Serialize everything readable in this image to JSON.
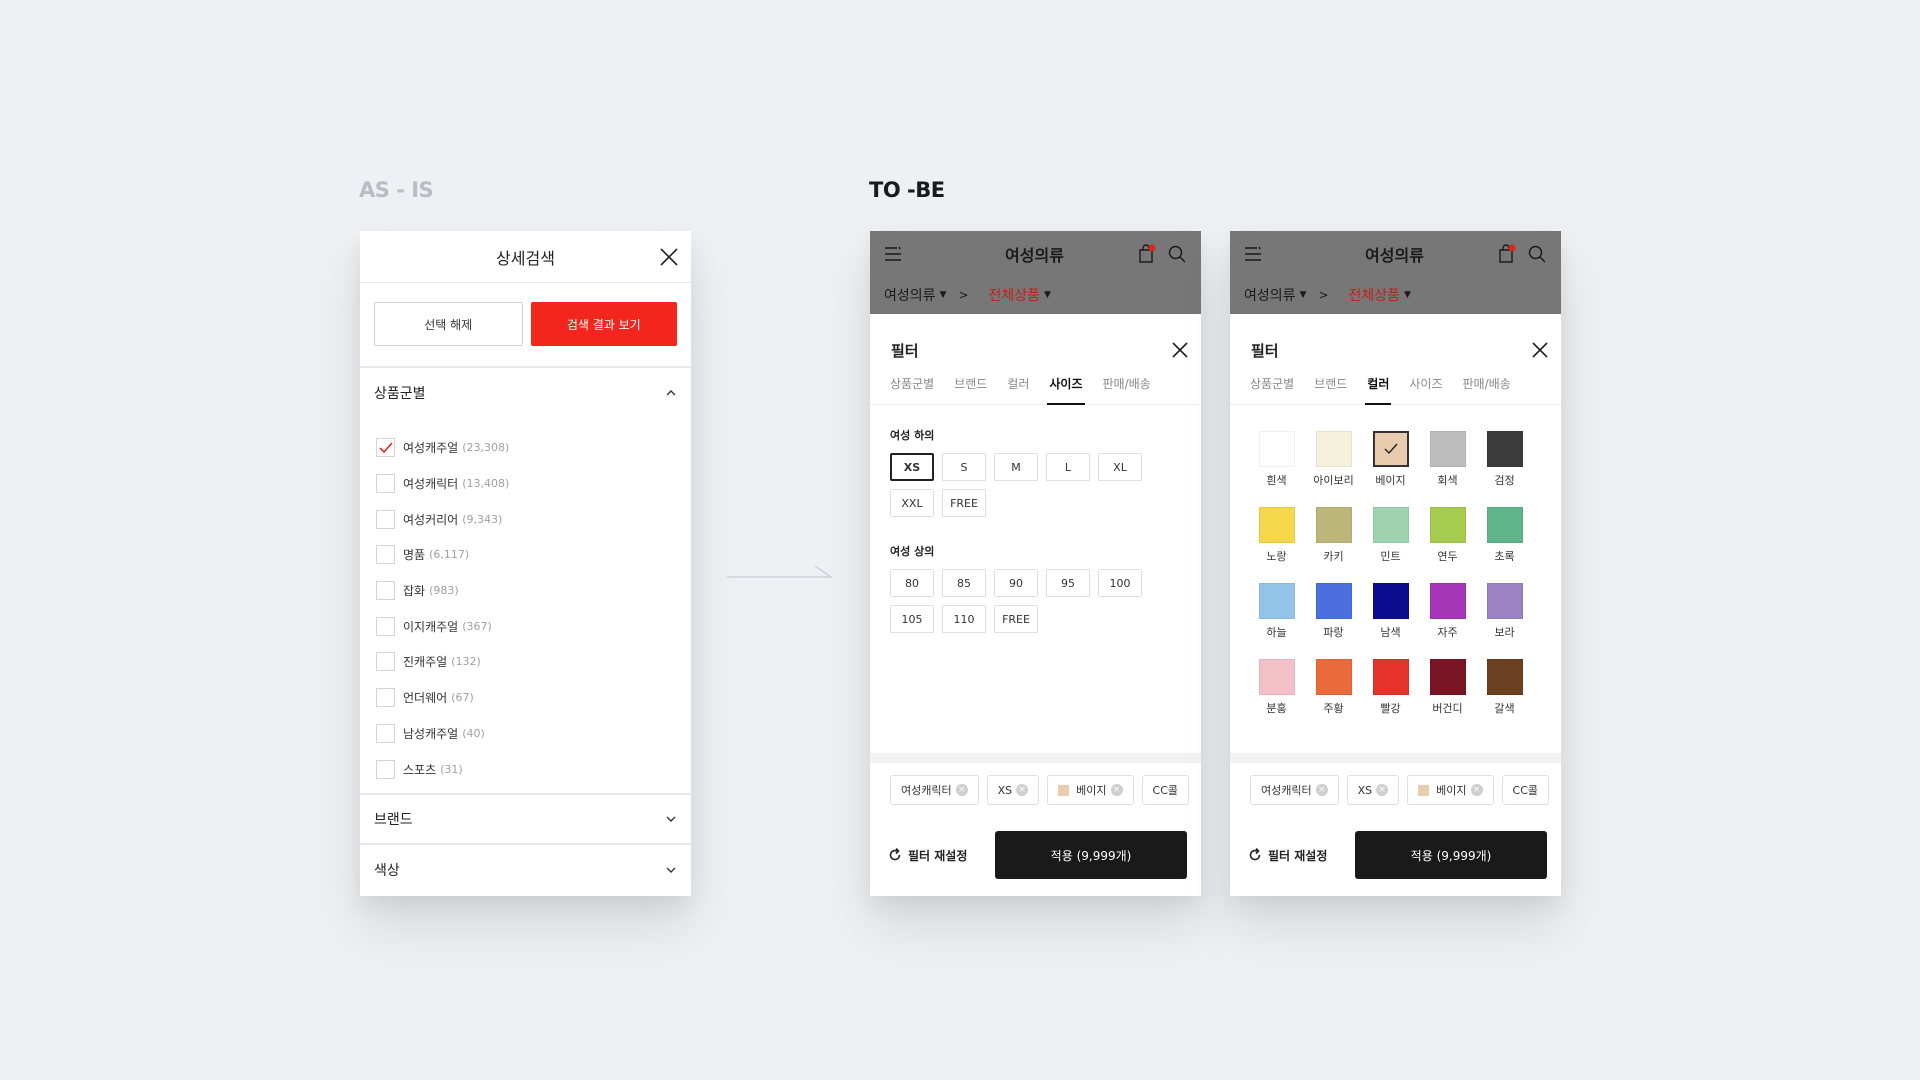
{
  "labels": {
    "asis": "AS - IS",
    "tobe": "TO -BE"
  },
  "asis": {
    "title": "상세검색",
    "btn_clear": "선택 해제",
    "btn_search": "검색 결과 보기",
    "section_category": "상품군별",
    "categories": [
      {
        "name": "여성캐주얼",
        "count": "(23,308)",
        "checked": true
      },
      {
        "name": "여성캐릭터",
        "count": "(13,408)",
        "checked": false
      },
      {
        "name": "여성커리어",
        "count": "(9,343)",
        "checked": false
      },
      {
        "name": "명품",
        "count": "(6,117)",
        "checked": false
      },
      {
        "name": "잡화",
        "count": "(983)",
        "checked": false
      },
      {
        "name": "이지캐주얼",
        "count": "(367)",
        "checked": false
      },
      {
        "name": "진캐주얼",
        "count": "(132)",
        "checked": false
      },
      {
        "name": "언더웨어",
        "count": "(67)",
        "checked": false
      },
      {
        "name": "남성캐주얼",
        "count": "(40)",
        "checked": false
      },
      {
        "name": "스포츠",
        "count": "(31)",
        "checked": false
      }
    ],
    "section_brand": "브랜드",
    "section_color": "색상"
  },
  "tobe": {
    "app_title": "여성의류",
    "cart_count": "0",
    "crumb_parent": "여성의류",
    "crumb_current": "전체상품",
    "filter_title": "필터",
    "tabs": [
      "상품군별",
      "브랜드",
      "컬러",
      "사이즈",
      "판매/배송"
    ],
    "size_group_bottom": "여성 하의",
    "sizes_bottom": [
      "XS",
      "S",
      "M",
      "L",
      "XL",
      "XXL",
      "FREE"
    ],
    "size_selected": "XS",
    "size_group_top": "여성 상의",
    "sizes_top": [
      "80",
      "85",
      "90",
      "95",
      "100",
      "105",
      "110",
      "FREE"
    ],
    "colors": [
      {
        "name": "흰색",
        "hex": "#ffffff"
      },
      {
        "name": "아이보리",
        "hex": "#f6f1dc"
      },
      {
        "name": "베이지",
        "hex": "#e9cbae",
        "selected": true
      },
      {
        "name": "회색",
        "hex": "#bdbdbd"
      },
      {
        "name": "검정",
        "hex": "#3c3c3c"
      },
      {
        "name": "노랑",
        "hex": "#f6d64a"
      },
      {
        "name": "카키",
        "hex": "#bdb67a"
      },
      {
        "name": "민트",
        "hex": "#9fd2ae"
      },
      {
        "name": "연두",
        "hex": "#a5cc4e"
      },
      {
        "name": "초록",
        "hex": "#5fb48a"
      },
      {
        "name": "하늘",
        "hex": "#92c4e8"
      },
      {
        "name": "파랑",
        "hex": "#4c6fe0"
      },
      {
        "name": "남색",
        "hex": "#0c0c8e"
      },
      {
        "name": "자주",
        "hex": "#a435b4"
      },
      {
        "name": "보라",
        "hex": "#9a82c4"
      },
      {
        "name": "분홍",
        "hex": "#f4c0c8"
      },
      {
        "name": "주황",
        "hex": "#ea6a3c"
      },
      {
        "name": "빨강",
        "hex": "#e5322a"
      },
      {
        "name": "버건디",
        "hex": "#7a1624"
      },
      {
        "name": "갈색",
        "hex": "#6a4020"
      }
    ],
    "selected_chips": [
      "여성캐릭터",
      "XS",
      "베이지",
      "CC콜"
    ],
    "reset_label": "필터 재설정",
    "apply_label": "적용 (9,999개)"
  }
}
